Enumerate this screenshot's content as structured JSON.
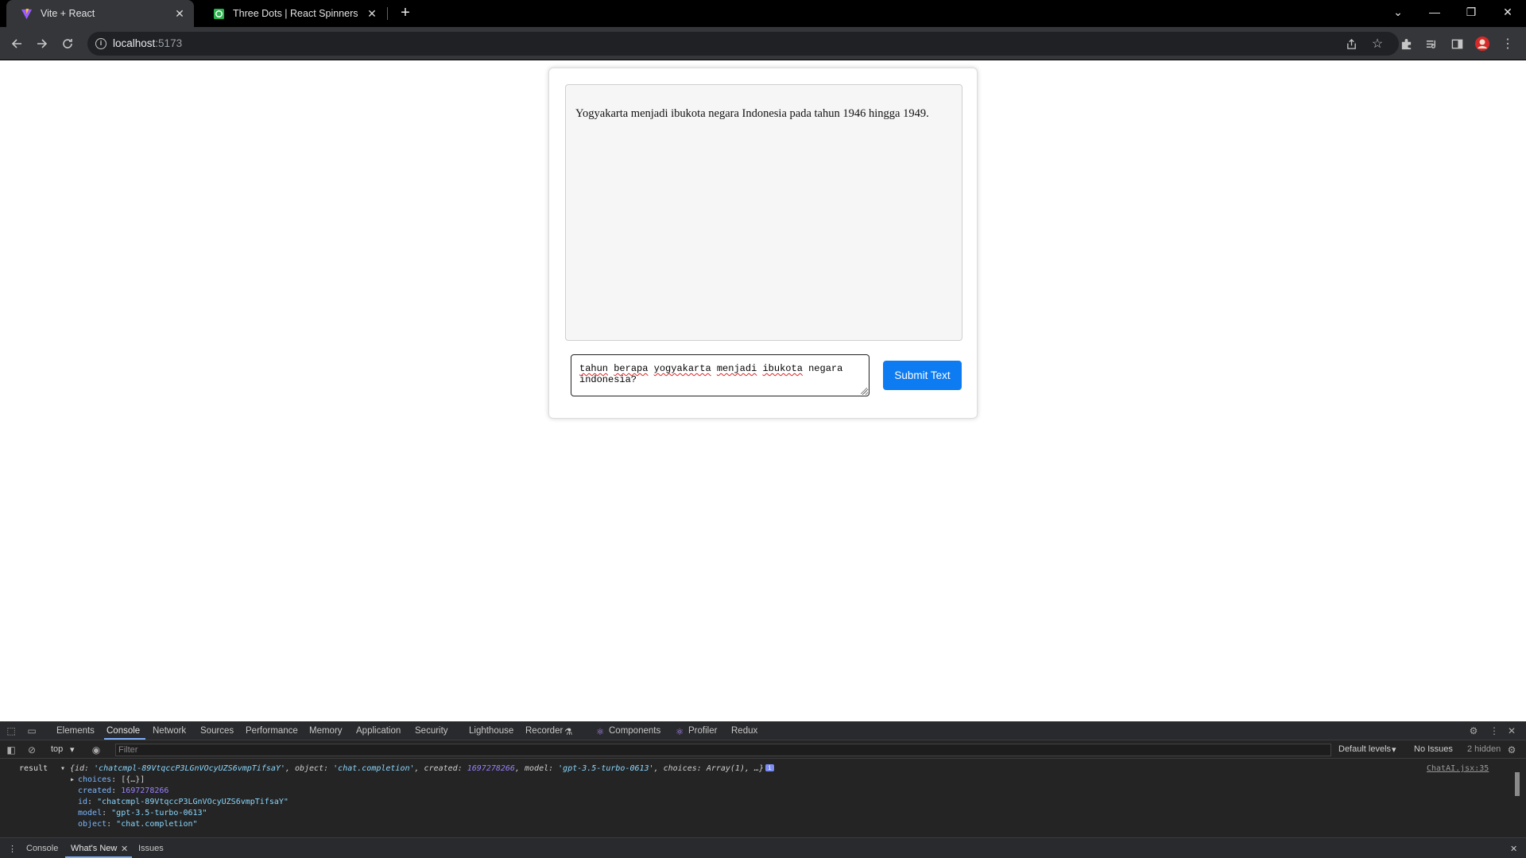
{
  "browser": {
    "tabs": [
      {
        "title": "Vite + React",
        "favicon": "vite-logo-icon",
        "active": true
      },
      {
        "title": "Three Dots | React Spinners",
        "favicon": "react-spinners-icon",
        "active": false
      }
    ],
    "url_host": "localhost",
    "url_port": ":5173"
  },
  "chat": {
    "answer": "Yogyakarta menjadi ibukota negara Indonesia pada tahun 1946 hingga 1949.",
    "prompt_line1_words": [
      "tahun",
      "berapa",
      "yogyakarta",
      "menjadi",
      "ibukota",
      "negara"
    ],
    "prompt_line2": "indonesia?",
    "submit_label": "Submit Text",
    "submit_color": "#0d7cf2"
  },
  "devtools": {
    "tabs": [
      "Elements",
      "Console",
      "Network",
      "Sources",
      "Performance",
      "Memory",
      "Application",
      "Security",
      "Lighthouse",
      "Recorder",
      "Components",
      "Profiler",
      "Redux"
    ],
    "active_tab": "Console",
    "context": "top",
    "filter_placeholder": "Filter",
    "levels": "Default levels",
    "issues": "No Issues",
    "hidden": "2 hidden",
    "log": {
      "label": "result",
      "summary_id": "'chatcmpl-89VtqccP3LGnVOcyUZS6vmpTifsaY'",
      "summary_object": "'chat.completion'",
      "summary_created": "1697278266",
      "summary_model": "'gpt-3.5-turbo-0613'",
      "summary_choices": "Array(1), …}",
      "choices": "[{…}]",
      "created": "1697278266",
      "id": "\"chatcmpl-89VtqccP3LGnVOcyUZS6vmpTifsaY\"",
      "model": "\"gpt-3.5-turbo-0613\"",
      "object": "\"chat.completion\"",
      "source": "ChatAI.jsx:35"
    },
    "drawer_tabs": [
      "Console",
      "What's New",
      "Issues"
    ]
  }
}
